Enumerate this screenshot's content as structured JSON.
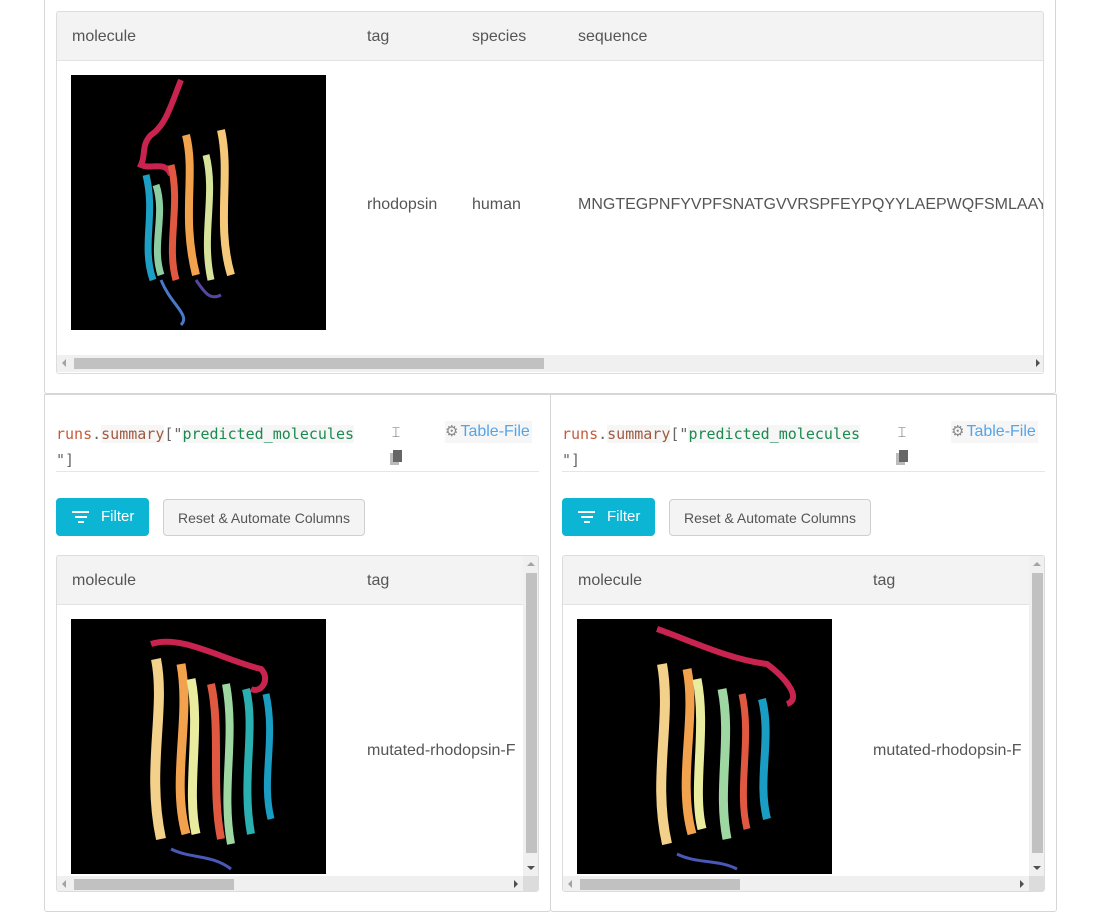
{
  "top_table": {
    "columns": [
      "molecule",
      "tag",
      "species",
      "sequence"
    ],
    "rows": [
      {
        "molecule_image": "rhodopsin-structure-render",
        "tag": "rhodopsin",
        "species": "human",
        "sequence": "MNGTEGPNFYVPFSNATGVVRSPFEYPQYYLAEPWQFSMLAAYMFLLI"
      }
    ]
  },
  "panels": [
    {
      "expression": {
        "object": "runs",
        "dot": ".",
        "property": "summary",
        "open": "[\"",
        "key": "predicted_molecules",
        "close": "\"]"
      },
      "type_label": "Table-File",
      "filter_label": "Filter",
      "reset_label": "Reset & Automate Columns",
      "columns": [
        "molecule",
        "tag"
      ],
      "rows": [
        {
          "molecule_image": "predicted-molecule-render",
          "tag": "mutated-rhodopsin-F"
        }
      ]
    },
    {
      "expression": {
        "object": "runs",
        "dot": ".",
        "property": "summary",
        "open": "[\"",
        "key": "predicted_molecules",
        "close": "\"]"
      },
      "type_label": "Table-File",
      "filter_label": "Filter",
      "reset_label": "Reset & Automate Columns",
      "columns": [
        "molecule",
        "tag"
      ],
      "rows": [
        {
          "molecule_image": "predicted-molecule-render",
          "tag": "mutated-rhodopsin-F"
        }
      ]
    }
  ],
  "colors": {
    "filter_button": "#0bb5d3",
    "type_link": "#56a4e8",
    "expr_keyword": "#c75a3a",
    "expr_string": "#1a8a4f"
  }
}
